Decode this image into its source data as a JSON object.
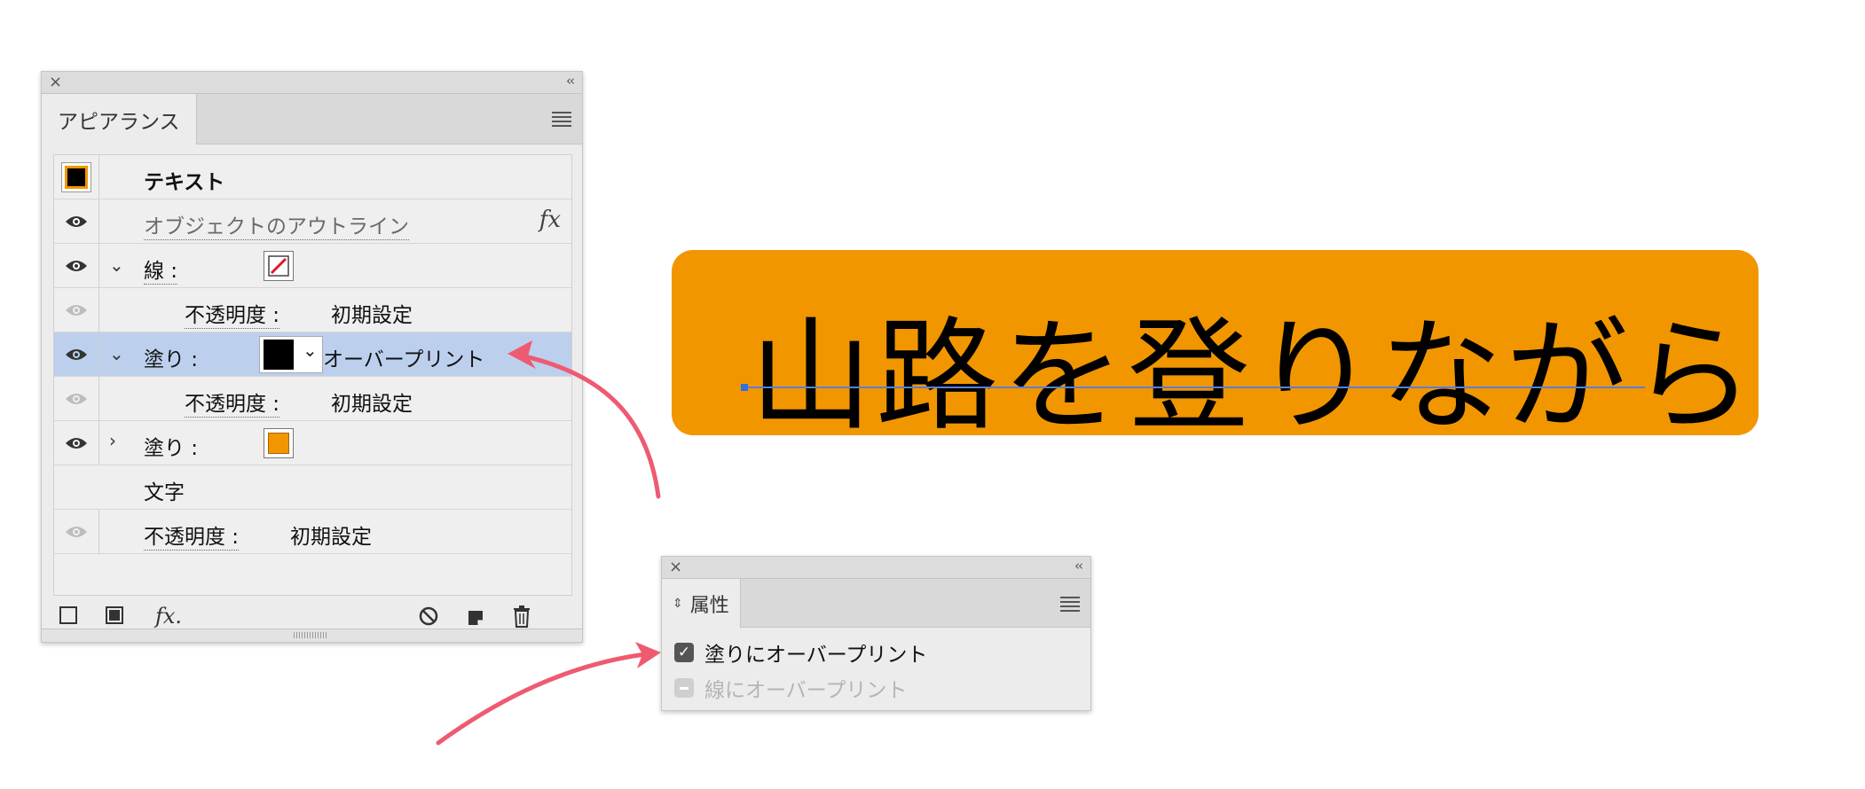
{
  "appearance_panel": {
    "tab_label": "アピアランス",
    "close_glyph": "×",
    "collapse_glyph": "‹‹",
    "rows": [
      {
        "label": "テキスト"
      },
      {
        "label": "オブジェクトのアウトライン",
        "fx": "fx"
      },
      {
        "label": "線 :"
      },
      {
        "label": "不透明度 :",
        "value": "初期設定"
      },
      {
        "label": "塗り :",
        "value": "オーバープリント"
      },
      {
        "label": "不透明度 :",
        "value": "初期設定"
      },
      {
        "label": "塗り :"
      },
      {
        "label": "文字"
      },
      {
        "label": "不透明度 :",
        "value": "初期設定"
      }
    ],
    "footer_fx": "fx."
  },
  "canvas_text": "山路を登りながら",
  "attributes_panel": {
    "tab_label": "属性",
    "close_glyph": "×",
    "collapse_glyph": "‹‹",
    "fill_overprint": {
      "label": "塗りにオーバープリント",
      "checked": true
    },
    "stroke_overprint": {
      "label": "線にオーバープリント",
      "checked": false,
      "disabled": true
    }
  },
  "colors": {
    "orange": "#f29600",
    "selected_row": "#bcd0ee",
    "arrow": "#ee5b71",
    "baseline": "#5a7fd6"
  }
}
